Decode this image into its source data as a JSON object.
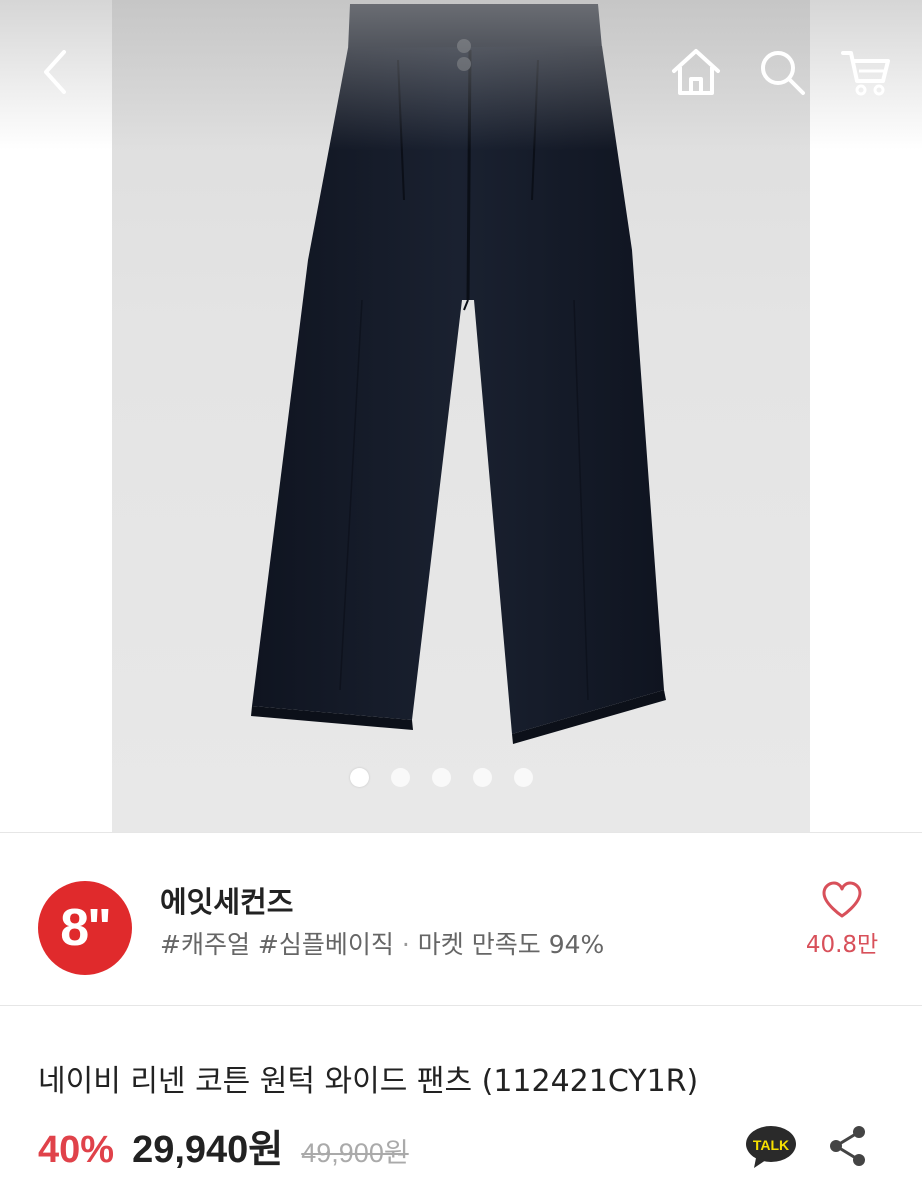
{
  "gallery": {
    "image_alt": "navy linen cotton one-tuck wide pants",
    "dots": [
      {
        "active": true
      },
      {
        "active": false
      },
      {
        "active": false
      },
      {
        "active": false
      },
      {
        "active": false
      }
    ]
  },
  "topbar": {
    "icons": [
      "back-icon",
      "home-icon",
      "search-icon",
      "cart-icon"
    ]
  },
  "shop": {
    "logo_text": "8\"",
    "name": "에잇세컨즈",
    "tags": "#캐주얼 #심플베이직",
    "separator": "·",
    "satisfaction": "마켓 만족도 94%",
    "likes": "40.8만"
  },
  "product": {
    "title": "네이비 리넨 코튼 원턱 와이드 팬츠 (112421CY1R)",
    "discount": "40%",
    "price": "29,940원",
    "original_price": "49,900원"
  },
  "actions": {
    "talk_label": "TALK"
  },
  "colors": {
    "brand_red": "#e02a2c",
    "discount_red": "#e0424a",
    "like_pink": "#d8505a",
    "pants_navy": "#141a26"
  }
}
